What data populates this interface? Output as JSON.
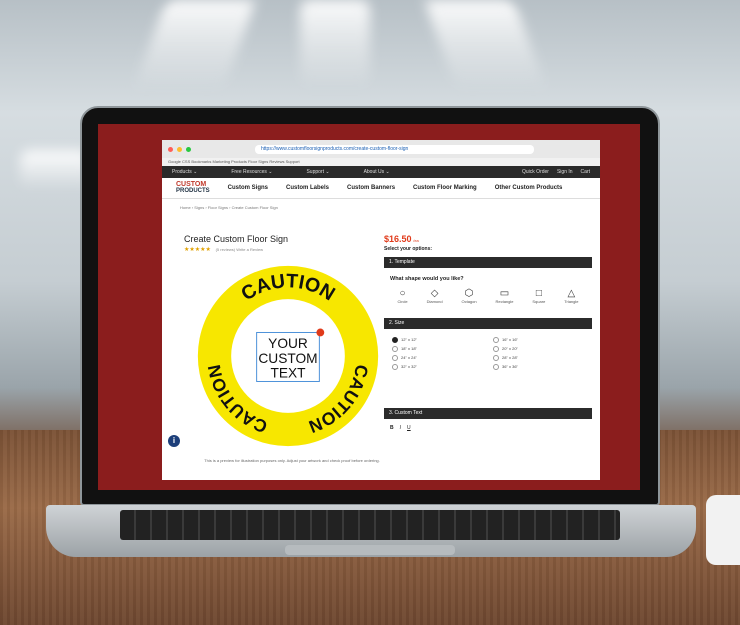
{
  "browser": {
    "url": "https://www.customfloorsignproducts.com/create-custom-floor-sign",
    "bookmarks": "Google   CSS   Bookmarks   Marketing   Products   Floor Signs   Reviews   Support"
  },
  "topnav": {
    "items": [
      "Products ⌄",
      "Free Resources ⌄",
      "Support ⌄",
      "About Us ⌄"
    ],
    "right": [
      "Quick Order",
      "Sign In",
      "Cart"
    ]
  },
  "brand": {
    "line1": "CUSTOM",
    "line2": "PRODUCTS"
  },
  "mainnav": [
    "Custom Signs",
    "Custom Labels",
    "Custom Banners",
    "Custom Floor Marking",
    "Other Custom Products"
  ],
  "breadcrumb": "Home  ›  Signs  ›  Floor Signs  ›  Create Custom Floor Sign",
  "product": {
    "title": "Create Custom Floor Sign",
    "stars": "★★★★★",
    "reviews": "(5 reviews)  Write a Review"
  },
  "sign": {
    "caution": "CAUTION",
    "line1": "YOUR",
    "line2": "CUSTOM",
    "line3": "TEXT",
    "disclaimer": "This is a preview for illustration purposes only. Adjust your artwork and check proof before ordering."
  },
  "options": {
    "price": "$16.50",
    "price_unit": "/ea",
    "select_label": "Select your options:",
    "section1": "1. Template",
    "shape_question": "What shape would you like?",
    "shapes": [
      "Circle",
      "Diamond",
      "Octagon",
      "Rectangle",
      "Square",
      "Triangle"
    ],
    "section2": "2. Size",
    "sizes": [
      "12\" x 12\"",
      "16\" x 16\"",
      "18\" x 18\"",
      "20\" x 20\"",
      "24\" x 24\"",
      "28\" x 28\"",
      "32\" x 32\"",
      "36\" x 36\""
    ],
    "section3": "3. Custom Text"
  },
  "colors": {
    "sign_yellow": "#f7e700",
    "accent_red": "#e03a1a",
    "dark_bar": "#2b2b2b"
  }
}
